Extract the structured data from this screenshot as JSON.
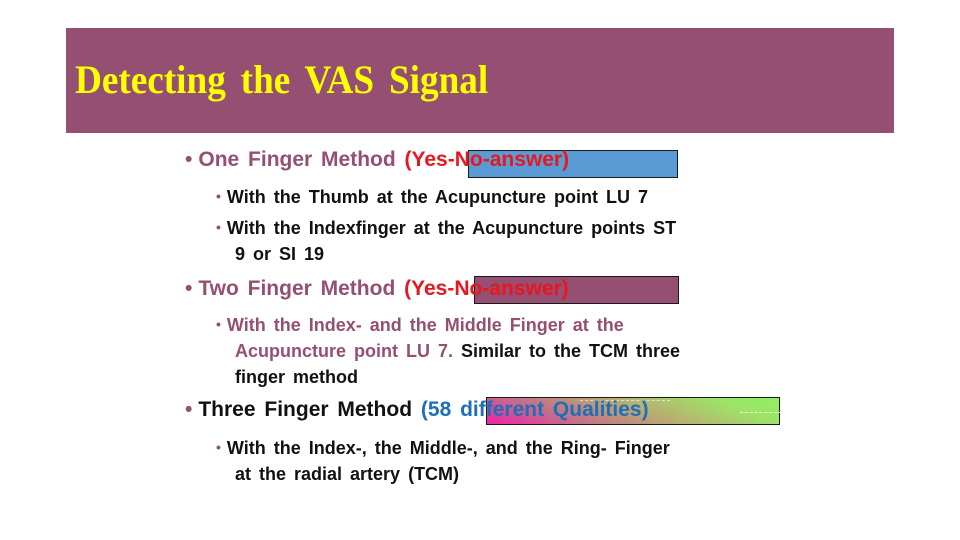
{
  "slide": {
    "title": "Detecting the VAS Signal",
    "colors": {
      "header_bg": "#954f72",
      "title_text": "#ffff00",
      "heading_text": "#954f72",
      "answer_red": "#e8161e",
      "qualities_blue": "#1f6fb8",
      "box_blue": "#5b9bd5",
      "box_mauve": "#954f72"
    },
    "sections": [
      {
        "heading": "One Finger Method",
        "note": "(Yes-No-answer)",
        "subitems": [
          {
            "text": "With the Thumb at the Acupuncture point LU 7"
          },
          {
            "line1": "With the Indexfinger at the Acupuncture points ST",
            "line2": "9 or SI 19"
          }
        ]
      },
      {
        "heading": "Two Finger Method",
        "note": "(Yes-No-answer)",
        "subitems": [
          {
            "line1": "With the Index- and the Middle Finger at the",
            "line2_colored": "Acupuncture point LU 7.",
            "line2_plain": "Similar to the TCM three",
            "line3": "finger method"
          }
        ]
      },
      {
        "heading": "Three Finger Method",
        "note": "(58 different Qualities)",
        "subitems": [
          {
            "line1": "With the Index-, the Middle-, and the Ring- Finger",
            "line2": "at the radial artery (TCM)"
          }
        ]
      }
    ]
  }
}
